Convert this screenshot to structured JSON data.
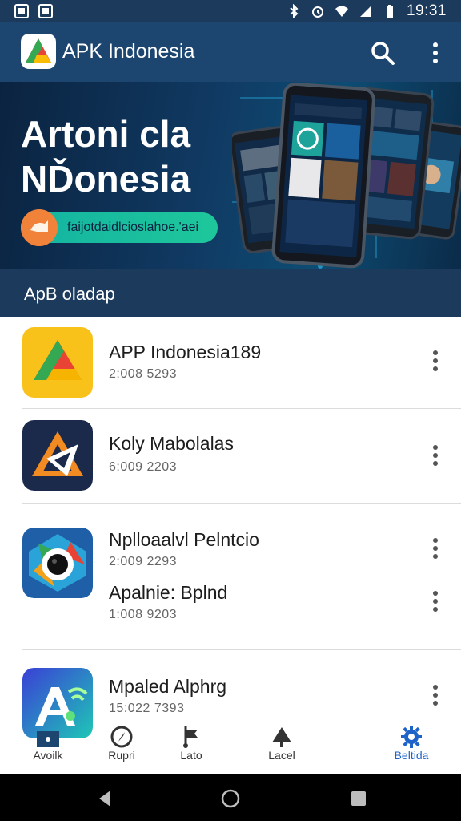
{
  "status_bar": {
    "time": "19:31"
  },
  "app_bar": {
    "title": "APK Indonesia"
  },
  "banner": {
    "title_line1": "Artoni cla",
    "title_line2": "NĎonesia",
    "pill_text": "faijotdaidlcioslahoe.'aei"
  },
  "section": {
    "title": "ApB oladap"
  },
  "apps": [
    {
      "name": "APP Indonesia189",
      "meta": "2:008 5293"
    },
    {
      "name": "Koly Mabolalas",
      "meta": "6:009 2203"
    },
    {
      "name": "Nplloaalvl Pelntcio",
      "meta": "2:009 2293"
    },
    {
      "name": "Apalnie: Bplnd",
      "meta": "1:008 9203"
    },
    {
      "name": "Mpaled Alphrg",
      "meta": "15:022 7393"
    }
  ],
  "bottom_nav": [
    {
      "label": "Avoilk",
      "icon": "home-card-icon",
      "active": false
    },
    {
      "label": "Rupri",
      "icon": "compass-icon",
      "active": false
    },
    {
      "label": "Lato",
      "icon": "flag-icon",
      "active": false
    },
    {
      "label": "Lacel",
      "icon": "tree-icon",
      "active": false
    },
    {
      "label": "Beltida",
      "icon": "gear-icon",
      "active": true
    }
  ],
  "colors": {
    "status_bar": "#1b3a5c",
    "app_bar": "#1c4570",
    "active_nav": "#1e63c8"
  }
}
